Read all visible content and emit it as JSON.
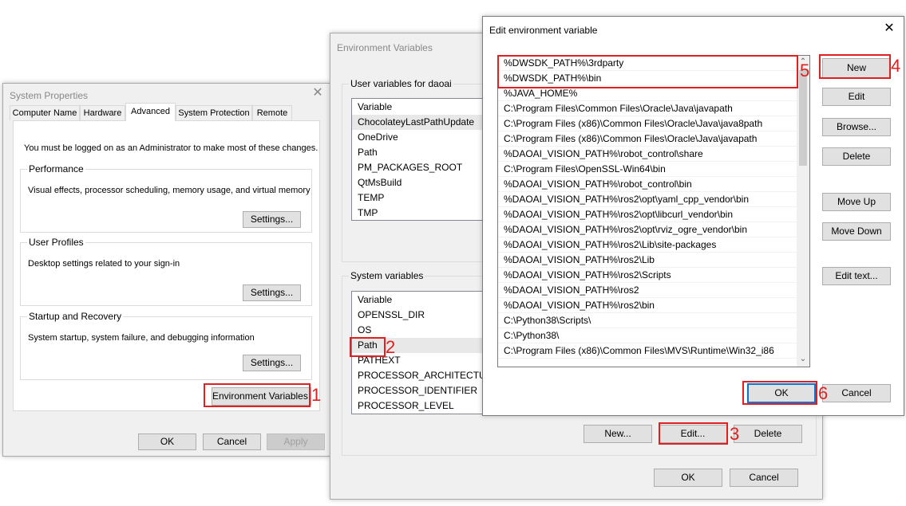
{
  "system_properties": {
    "title": "System Properties",
    "tabs": [
      "Computer Name",
      "Hardware",
      "Advanced",
      "System Protection",
      "Remote"
    ],
    "admin_note": "You must be logged on as an Administrator to make most of these changes.",
    "performance": {
      "title": "Performance",
      "desc": "Visual effects, processor scheduling, memory usage, and virtual memory",
      "button": "Settings..."
    },
    "user_profiles": {
      "title": "User Profiles",
      "desc": "Desktop settings related to your sign-in",
      "button": "Settings..."
    },
    "startup": {
      "title": "Startup and Recovery",
      "desc": "System startup, system failure, and debugging information",
      "button": "Settings..."
    },
    "env_button": "Environment Variables...",
    "ok": "OK",
    "cancel": "Cancel",
    "apply": "Apply"
  },
  "env_vars": {
    "title": "Environment Variables",
    "user_group": "User variables for daoai",
    "user_header": "Variable",
    "user_rows": [
      "ChocolateyLastPathUpdate",
      "OneDrive",
      "Path",
      "PM_PACKAGES_ROOT",
      "QtMsBuild",
      "TEMP",
      "TMP"
    ],
    "system_group": "System variables",
    "system_header": "Variable",
    "system_rows": [
      "OPENSSL_DIR",
      "OS",
      "Path",
      "PATHEXT",
      "PROCESSOR_ARCHITECTURE",
      "PROCESSOR_IDENTIFIER",
      "PROCESSOR_LEVEL"
    ],
    "new": "New...",
    "edit": "Edit...",
    "delete": "Delete",
    "ok": "OK",
    "cancel": "Cancel"
  },
  "edit_env": {
    "title": "Edit environment variable",
    "rows": [
      "%DWSDK_PATH%\\3rdparty",
      "%DWSDK_PATH%\\bin",
      "%JAVA_HOME%",
      "C:\\Program Files\\Common Files\\Oracle\\Java\\javapath",
      "C:\\Program Files (x86)\\Common Files\\Oracle\\Java\\java8path",
      "C:\\Program Files (x86)\\Common Files\\Oracle\\Java\\javapath",
      "%DAOAI_VISION_PATH%\\robot_control\\share",
      "C:\\Program Files\\OpenSSL-Win64\\bin",
      "%DAOAI_VISION_PATH%\\robot_control\\bin",
      "%DAOAI_VISION_PATH%\\ros2\\opt\\yaml_cpp_vendor\\bin",
      "%DAOAI_VISION_PATH%\\ros2\\opt\\libcurl_vendor\\bin",
      "%DAOAI_VISION_PATH%\\ros2\\opt\\rviz_ogre_vendor\\bin",
      "%DAOAI_VISION_PATH%\\ros2\\Lib\\site-packages",
      "%DAOAI_VISION_PATH%\\ros2\\Lib",
      "%DAOAI_VISION_PATH%\\ros2\\Scripts",
      "%DAOAI_VISION_PATH%\\ros2",
      "%DAOAI_VISION_PATH%\\ros2\\bin",
      "C:\\Python38\\Scripts\\",
      "C:\\Python38\\",
      "C:\\Program Files (x86)\\Common Files\\MVS\\Runtime\\Win32_i86"
    ],
    "buttons": {
      "new": "New",
      "edit": "Edit",
      "browse": "Browse...",
      "delete": "Delete",
      "move_up": "Move Up",
      "move_down": "Move Down",
      "edit_text": "Edit text..."
    },
    "ok": "OK",
    "cancel": "Cancel"
  },
  "annotations": [
    "1",
    "2",
    "3",
    "4",
    "5",
    "6"
  ],
  "colors": {
    "annotation": "#e02020",
    "focus": "#0078d7",
    "selection": "#e5f3ff"
  },
  "icons": {
    "close": "close-icon",
    "scroll_up": "chevron-up-icon",
    "scroll_down": "chevron-down-icon"
  }
}
